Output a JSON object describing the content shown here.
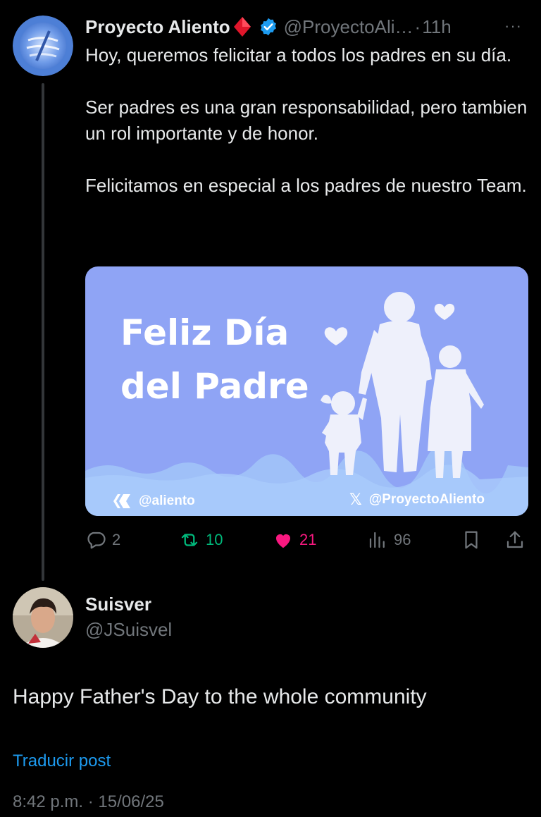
{
  "tweet": {
    "author_name": "Proyecto Aliento",
    "author_handle": "@ProyectoAli…",
    "separator": "·",
    "time": "11h",
    "more": "···",
    "paragraphs": [
      "Hoy, queremos felicitar a todos los padres en su día.",
      "Ser padres es una gran responsabilidad, pero tambien un rol importante y de honor.",
      "Felicitamos en especial a los padres de nuestro Team."
    ],
    "media": {
      "title_line1": "Feliz Día",
      "title_line2": "del Padre",
      "tag_left": "@aliento",
      "tag_right": "@ProyectoAliento",
      "bg_color": "#8fa4f5"
    },
    "actions": {
      "replies": "2",
      "retweets": "10",
      "likes": "21",
      "views": "96"
    }
  },
  "reply": {
    "author_name": "Suisver",
    "author_handle": "@JSuisvel",
    "text": "Happy Father's Day to the whole community",
    "translate_label": "Traducir post",
    "timestamp": "8:42 p.m. · 15/06/25"
  },
  "colors": {
    "background": "#000000",
    "text": "#e7e9ea",
    "muted": "#71767b",
    "link": "#1d9bf0",
    "retweet": "#00ba7c",
    "like": "#f91880",
    "verified": "#1d9bf0"
  }
}
